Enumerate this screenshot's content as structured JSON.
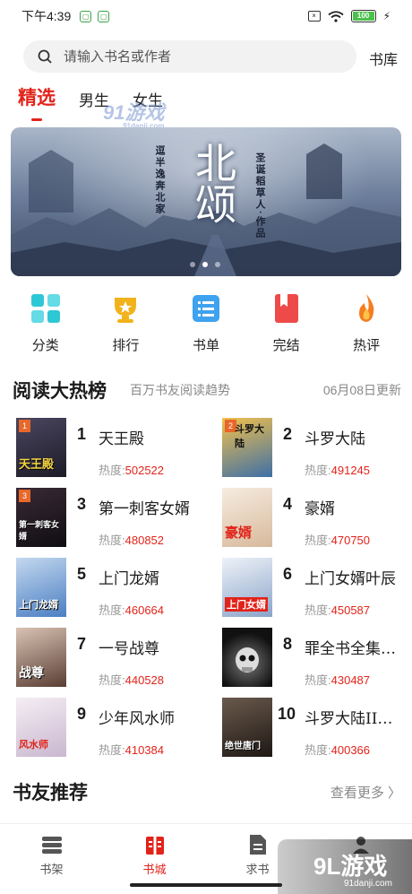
{
  "status_bar": {
    "time": "下午4:39",
    "battery": "100"
  },
  "search": {
    "placeholder": "请输入书名或作者",
    "library_label": "书库"
  },
  "tabs": [
    {
      "label": "精选",
      "active": true
    },
    {
      "label": "男生",
      "active": false
    },
    {
      "label": "女生",
      "active": false
    }
  ],
  "banner": {
    "title": "北颂",
    "sub_left": "逗半逸奔北家",
    "sub_right": "圣诞稻草人·作品",
    "page_count": 3,
    "current_page": 2
  },
  "categories": [
    {
      "label": "分类",
      "icon": "grid-icon",
      "color": "#2ec7d6"
    },
    {
      "label": "排行",
      "icon": "trophy-icon",
      "color": "#f2b21b"
    },
    {
      "label": "书单",
      "icon": "list-icon",
      "color": "#3ea2ef"
    },
    {
      "label": "完结",
      "icon": "bookmark-book-icon",
      "color": "#ef4a4a"
    },
    {
      "label": "热评",
      "icon": "flame-icon",
      "color": "#f57c1f"
    }
  ],
  "ranking": {
    "title": "阅读大热榜",
    "subtitle": "百万书友阅读趋势",
    "date": "06月08日更新",
    "heat_label": "热度:",
    "items": [
      {
        "rank": "1",
        "name": "天王殿",
        "heat": "502522",
        "badge": "1",
        "cover_text": "天王殿",
        "cover_color": "#2b2a3a"
      },
      {
        "rank": "2",
        "name": "斗罗大陆",
        "heat": "491245",
        "badge": "2",
        "cover_text": "斗罗大陆",
        "cover_color": "#3d6fa6"
      },
      {
        "rank": "3",
        "name": "第一刺客女婿",
        "heat": "480852",
        "badge": "3",
        "cover_text": "第一刺客女婿",
        "cover_color": "#1f1a22"
      },
      {
        "rank": "4",
        "name": "豪婿",
        "heat": "470750",
        "badge": "",
        "cover_text": "豪婿",
        "cover_color": "#e7d6c4"
      },
      {
        "rank": "5",
        "name": "上门龙婿",
        "heat": "460664",
        "badge": "",
        "cover_text": "上门龙婿",
        "cover_color": "#6f9dd6"
      },
      {
        "rank": "6",
        "name": "上门女婿叶辰",
        "heat": "450587",
        "badge": "",
        "cover_text": "上门女婿",
        "cover_color": "#c8d7ea"
      },
      {
        "rank": "7",
        "name": "一号战尊",
        "heat": "440528",
        "badge": "",
        "cover_text": "战尊",
        "cover_color": "#8a6f62"
      },
      {
        "rank": "8",
        "name": "罪全书全集…",
        "heat": "430487",
        "badge": "",
        "cover_text": "",
        "cover_color": "#2a2a2a"
      },
      {
        "rank": "9",
        "name": "少年风水师",
        "heat": "410384",
        "badge": "",
        "cover_text": "风水师",
        "cover_color": "#dfd7e2"
      },
      {
        "rank": "10",
        "name": "斗罗大陆II…",
        "heat": "400366",
        "badge": "",
        "cover_text": "绝世唐门",
        "cover_color": "#4a3d34"
      }
    ]
  },
  "recommend": {
    "title": "书友推荐",
    "more_label": "查看更多 〉"
  },
  "bottom_nav": [
    {
      "label": "书架",
      "icon": "bookshelf-icon",
      "active": false
    },
    {
      "label": "书城",
      "icon": "bookstore-icon",
      "active": true
    },
    {
      "label": "求书",
      "icon": "request-book-icon",
      "active": false
    },
    {
      "label": "",
      "icon": "profile-icon",
      "active": false
    }
  ],
  "watermark": {
    "top": "91游戏",
    "top_small": "91danji.com",
    "bottom": "9L游戏",
    "bottom_small": "91danji.com"
  },
  "accent_color": "#e2231a"
}
